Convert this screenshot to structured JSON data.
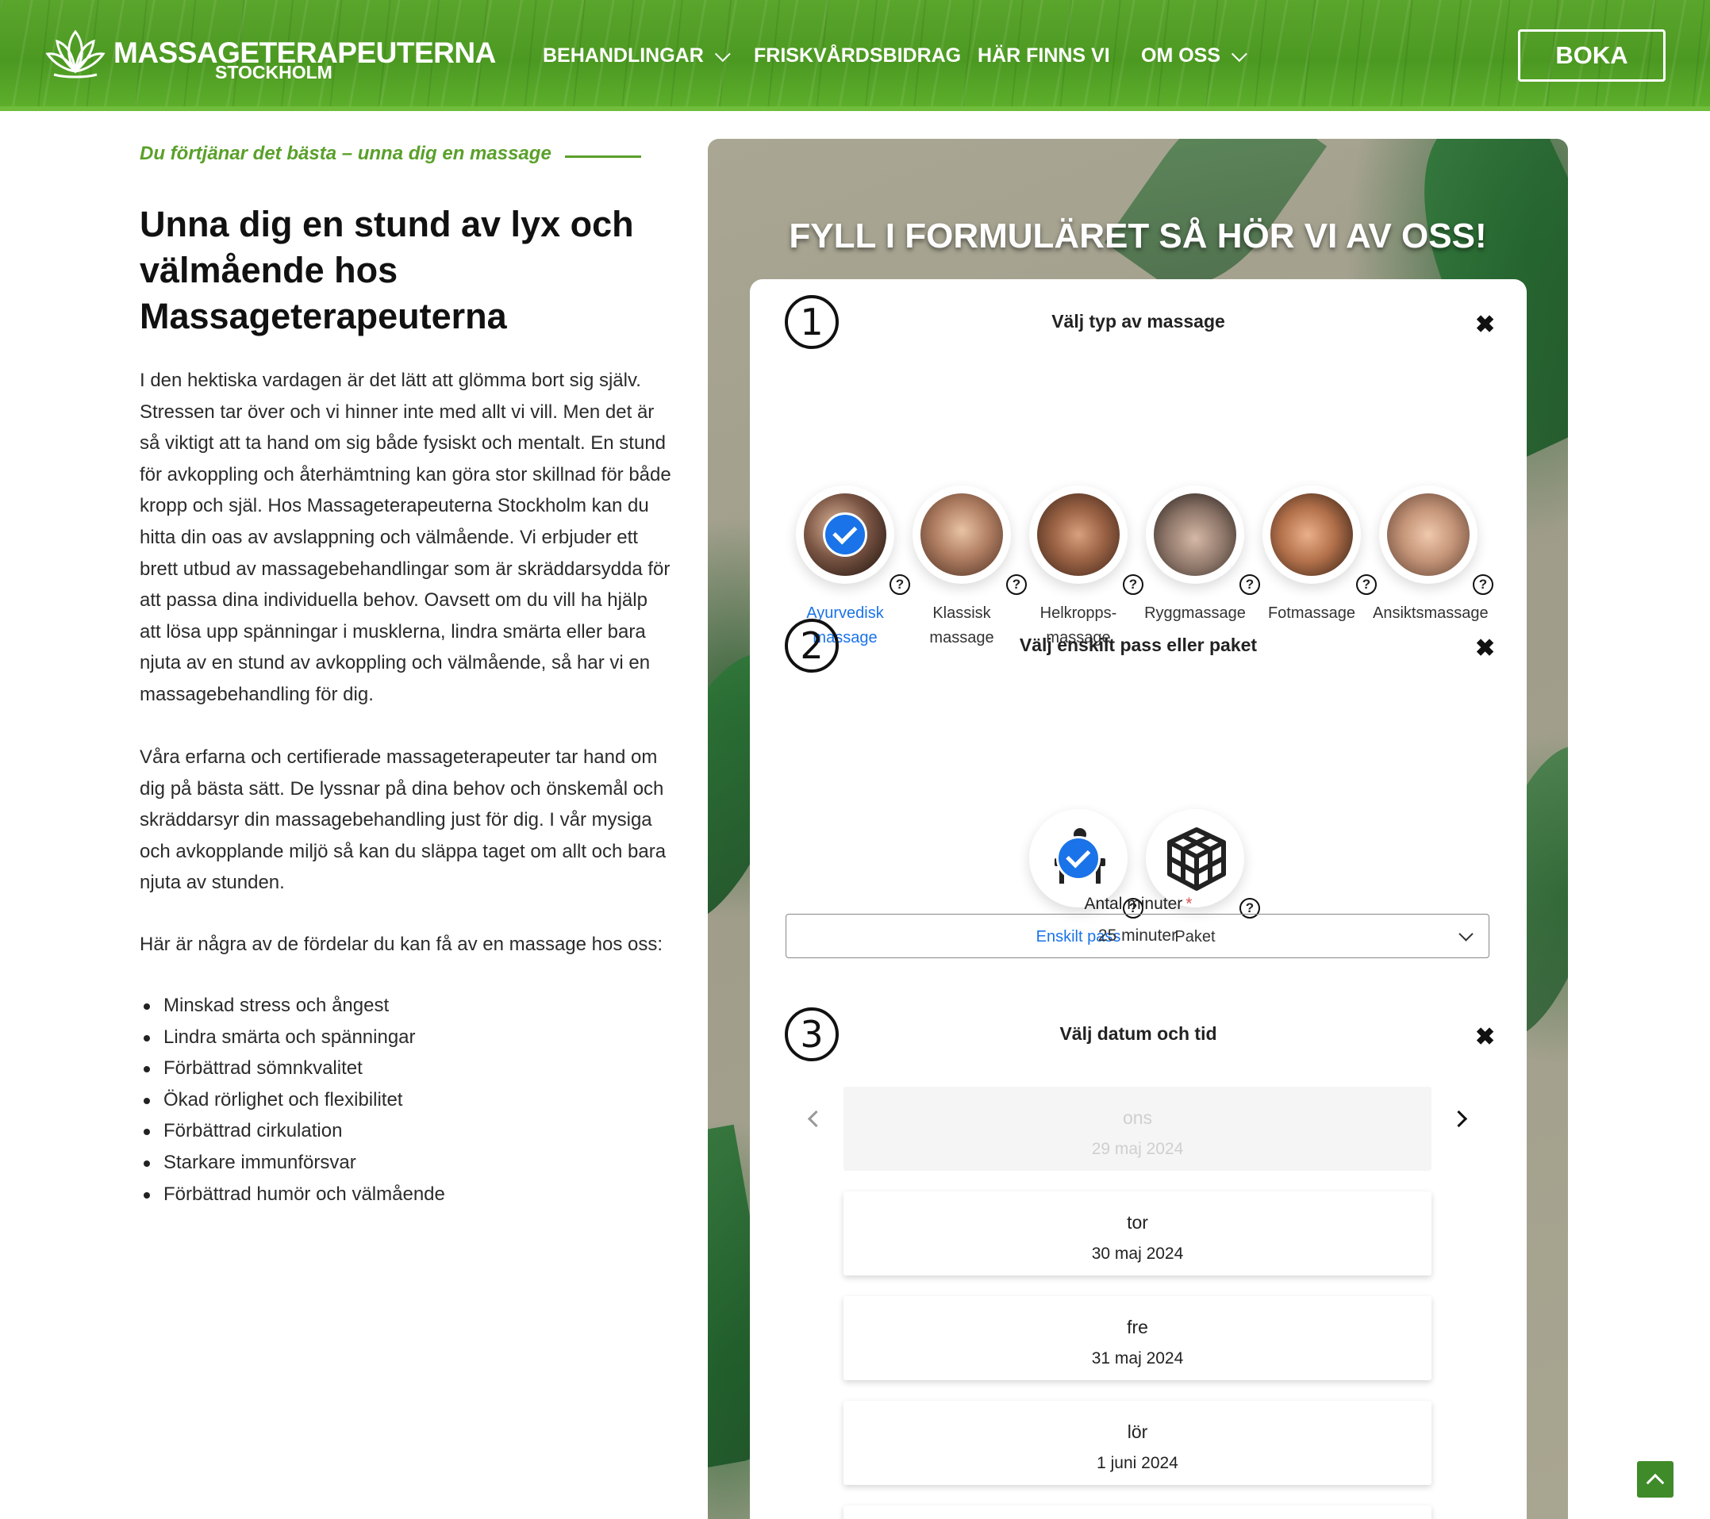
{
  "header": {
    "logo_title": "MASSAGETERAPEUTERNA",
    "logo_subtitle": "STOCKHOLM",
    "nav": [
      {
        "label": "BEHANDLINGAR",
        "has_dropdown": true
      },
      {
        "label": "FRISKVÅRDSBIDRAG",
        "has_dropdown": false
      },
      {
        "label": "HÄR FINNS VI",
        "has_dropdown": false
      },
      {
        "label": "OM OSS",
        "has_dropdown": true
      }
    ],
    "cta_label": "BOKA"
  },
  "intro": {
    "tagline": "Du förtjänar det bästa – unna dig en massage",
    "headline": "Unna dig en stund av lyx och välmående hos Massageterapeuterna",
    "paragraph1": "I den hektiska vardagen är det lätt att glömma bort sig själv. Stressen tar över och vi hinner inte med allt vi vill. Men det är så viktigt att ta hand om sig både fysiskt och mentalt. En stund för avkoppling och återhämtning kan göra stor skillnad för både kropp och själ. Hos Massageterapeuterna Stockholm kan du hitta din oas av avslappning och välmående. Vi erbjuder ett brett utbud av massagebehandlingar som är skräddarsydda för att passa dina individuella behov. Oavsett om du vill ha hjälp att lösa upp spänningar i musklerna, lindra smärta eller bara njuta av en stund av avkoppling och välmående, så har vi en massagebehandling för dig.",
    "paragraph2": "Våra erfarna och certifierade massageterapeuter tar hand om dig på bästa sätt. De lyssnar på dina behov och önskemål och skräddarsyr din massagebehandling just för dig. I vår mysiga och avkopplande miljö så kan du släppa taget om allt och bara njuta av stunden.",
    "paragraph3": "Här är några av de fördelar du kan få av en massage hos oss:",
    "benefits": [
      "Minskad stress och ångest",
      "Lindra smärta och spänningar",
      "Förbättrad sömnkvalitet",
      "Ökad rörlighet och flexibilitet",
      "Förbättrad cirkulation",
      "Starkare immunförsvar",
      "Förbättrad humör och välmående"
    ]
  },
  "form": {
    "title": "FYLL I FORMULÄRET SÅ HÖR VI AV OSS!",
    "step1": {
      "number": "1",
      "title": "Välj typ av massage",
      "close": "✖",
      "options": [
        {
          "label": "Ayurvedisk massage",
          "selected": true
        },
        {
          "label": "Klassisk massage",
          "selected": false
        },
        {
          "label": "Helkropps-massage",
          "selected": false
        },
        {
          "label": "Ryggmassage",
          "selected": false
        },
        {
          "label": "Fotmassage",
          "selected": false
        },
        {
          "label": "Ansiktsmassage",
          "selected": false
        }
      ],
      "help": "?"
    },
    "step2": {
      "number": "2",
      "title": "Välj enskilt pass eller paket",
      "close": "✖",
      "options": [
        {
          "label": "Enskilt pass",
          "icon": "massage-table-icon",
          "selected": true
        },
        {
          "label": "Paket",
          "icon": "cube-icon",
          "selected": false
        }
      ],
      "minutes_label": "Antal minuter",
      "required_mark": "*",
      "minutes_value": "25 minuter"
    },
    "step3": {
      "number": "3",
      "title": "Välj datum och tid",
      "close": "✖",
      "dates": [
        {
          "day": "ons",
          "date": "29 maj 2024",
          "disabled": true
        },
        {
          "day": "tor",
          "date": "30 maj 2024",
          "disabled": false
        },
        {
          "day": "fre",
          "date": "31 maj 2024",
          "disabled": false
        },
        {
          "day": "lör",
          "date": "1 juni 2024",
          "disabled": false
        }
      ]
    }
  },
  "colors": {
    "brand_green": "#5aa02a",
    "selected_blue": "#1a73e8",
    "back_to_top": "#3f8b2a"
  }
}
